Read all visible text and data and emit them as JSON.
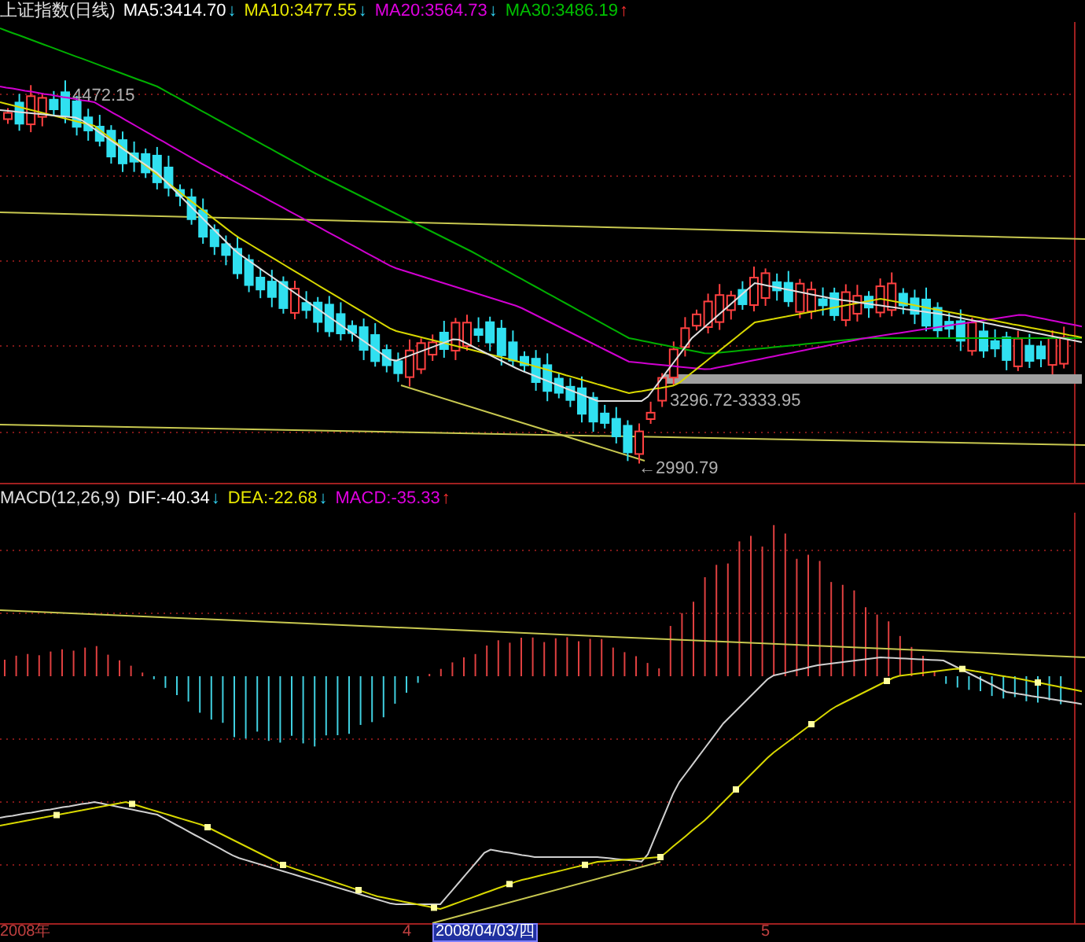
{
  "price_panel": {
    "title": "上证指数(日线)",
    "indicators": [
      {
        "label": "MA5:3414.70",
        "arrow": "↓",
        "kind": "down",
        "color": "#ffffff"
      },
      {
        "label": "MA10:3477.55",
        "arrow": "↓",
        "kind": "down",
        "color": "#e8e800"
      },
      {
        "label": "MA20:3564.73",
        "arrow": "↓",
        "kind": "down",
        "color": "#e000e0"
      },
      {
        "label": "MA30:3486.19",
        "arrow": "↑",
        "kind": "up",
        "color": "#00c000"
      }
    ],
    "annotations": [
      "4472.15",
      "3296.72-3333.95",
      "←2990.79"
    ]
  },
  "macd_panel": {
    "title": "MACD(12,26,9)",
    "indicators": [
      {
        "label": "DIF:-40.34",
        "arrow": "↓",
        "kind": "down",
        "color": "#ffffff"
      },
      {
        "label": "DEA:-22.68",
        "arrow": "↓",
        "kind": "down",
        "color": "#e8e800"
      },
      {
        "label": "MACD:-35.33",
        "arrow": "↑",
        "kind": "up",
        "color": "#e000e0"
      }
    ]
  },
  "time_axis": [
    {
      "text": "2008年",
      "kind": "tick"
    },
    {
      "text": "4",
      "kind": "tick"
    },
    {
      "text": "2008/04/03/四",
      "kind": "cursor"
    },
    {
      "text": "5",
      "kind": "tick"
    }
  ]
}
